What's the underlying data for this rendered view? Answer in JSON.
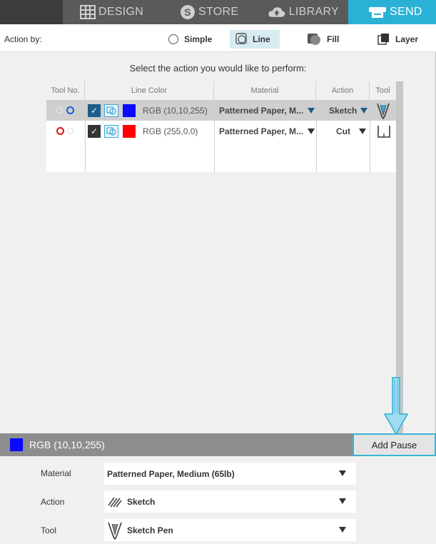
{
  "nav": {
    "tabs": [
      {
        "label": "DESIGN",
        "icon": "design-grid-icon"
      },
      {
        "label": "STORE",
        "icon": "store-s-icon"
      },
      {
        "label": "LIBRARY",
        "icon": "cloud-library-icon"
      },
      {
        "label": "SEND",
        "icon": "send-cutter-icon",
        "active": true
      }
    ]
  },
  "actionbar": {
    "label": "Action by:",
    "modes": [
      {
        "label": "Simple",
        "icon": "radio-icon"
      },
      {
        "label": "Line",
        "icon": "line-icon",
        "active": true
      },
      {
        "label": "Fill",
        "icon": "fill-icon"
      },
      {
        "label": "Layer",
        "icon": "layer-icon"
      }
    ]
  },
  "prompt": "Select the action you would like to perform:",
  "table": {
    "headers": [
      "Tool No.",
      "Line Color",
      "Material",
      "Action",
      "Tool"
    ],
    "rows": [
      {
        "rgb": "RGB (10,10,255)",
        "swatch": "#0a0aff",
        "material": "Patterned Paper, M...",
        "action": "Sketch",
        "tool": "sketch-pen-icon",
        "selected": true,
        "tool_dot_color": "#1e5fd6"
      },
      {
        "rgb": "RGB (255,0,0)",
        "swatch": "#ff0000",
        "material": "Patterned Paper, M...",
        "action": "Cut",
        "tool": "blade-icon",
        "selected": false,
        "tool_dot_color": "#e01010"
      }
    ]
  },
  "bottombar": {
    "rgb": "RGB (10,10,255)",
    "swatch": "#0a0aff",
    "add_pause": "Add Pause"
  },
  "properties": {
    "material_label": "Material",
    "material_value": "Patterned Paper, Medium (65lb)",
    "action_label": "Action",
    "action_value": "Sketch",
    "tool_label": "Tool",
    "tool_value": "Sketch Pen"
  },
  "colors": {
    "accent": "#2bb1d6",
    "nav_bg": "#5a5a5a"
  }
}
